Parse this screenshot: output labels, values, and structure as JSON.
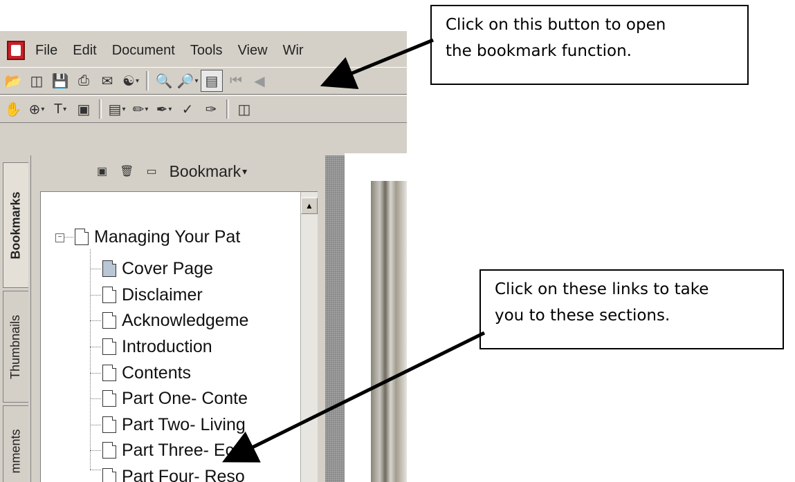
{
  "menu": [
    "File",
    "Edit",
    "Document",
    "Tools",
    "View",
    "Wir"
  ],
  "toolbar1": {
    "icons": [
      "open-icon",
      "print-setup-icon",
      "save-icon",
      "print-icon",
      "email-icon",
      "web-icon",
      "search-icon",
      "find-icon",
      "navigation-pane-icon",
      "first-page-icon",
      "previous-page-icon"
    ]
  },
  "toolbar2": {
    "icons": [
      "hand-tool-icon",
      "zoom-icon",
      "text-select-icon",
      "snapshot-icon",
      "note-icon",
      "pencil-icon",
      "highlighter-icon",
      "spellcheck-icon",
      "sign-icon",
      "page-layout-icon"
    ]
  },
  "nav_tabs": [
    "Bookmarks",
    "Thumbnails",
    "mments"
  ],
  "bookmarks_panel": {
    "options_label": "Bookmark",
    "items": [
      "Managing Your Pat",
      "Cover Page",
      "Disclaimer",
      "Acknowledgeme",
      "Introduction",
      "Contents",
      "Part One- Conte",
      "Part Two- Living",
      "Part Three- Eco",
      "Part Four- Reso"
    ]
  },
  "callouts": {
    "top": [
      "Click on this button to open",
      "the bookmark function."
    ],
    "bottom": [
      "Click on these links to take",
      "you to these sections."
    ]
  }
}
